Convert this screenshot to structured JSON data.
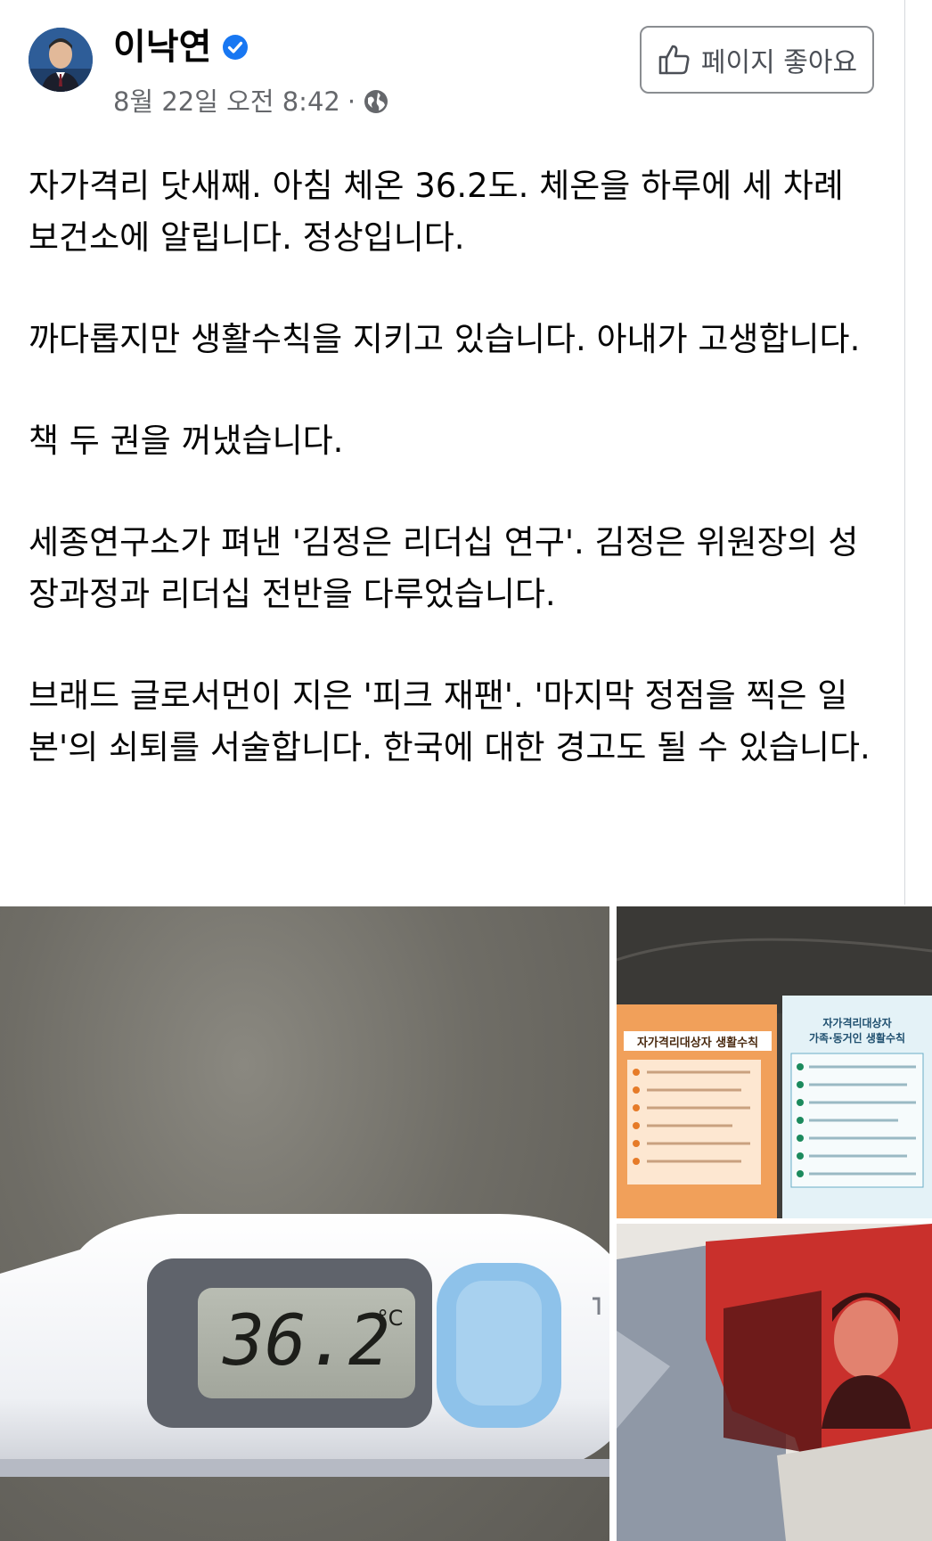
{
  "post": {
    "author": "이낙연",
    "date": "8월 22일 오전 8:42",
    "separator": "·",
    "like_page_label": "페이지 좋아요",
    "paragraphs": [
      "자가격리 닷새째. 아침 체온 36.2도. 체온을 하루에 세 차례 보건소에 알립니다. 정상입니다.",
      "까다롭지만 생활수칙을 지키고 있습니다. 아내가 고생합니다.",
      "책 두 권을 꺼냈습니다.",
      "세종연구소가 펴낸 '김정은 리더십 연구'. 김정은 위원장의 성장과정과 리더십 전반을 다루었습니다.",
      "브래드 글로서먼이 지은 '피크 재팬'. '마지막 정점을 찍은 일본'의 쇠퇴를 서술합니다. 한국에 대한 경고도 될 수 있습니다."
    ]
  },
  "photos": {
    "thermometer_reading": "36.2",
    "thermometer_unit": "°C",
    "papers_left_title": "자가격리대상자 생활수칙",
    "papers_right_title_1": "자가격리대상자",
    "papers_right_title_2": "가족·동거인 생활수칙"
  },
  "colors": {
    "verified_badge": "#1877f2",
    "secondary_text": "#65676b",
    "orange_leaflet": "#f1a05a",
    "blue_leaflet": "#e4f2f7"
  },
  "icons": [
    "verified-badge-icon",
    "globe-icon",
    "thumbs-up-icon"
  ]
}
